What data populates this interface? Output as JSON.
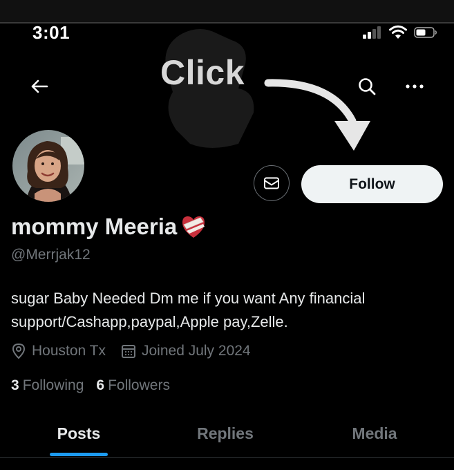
{
  "status_bar": {
    "time": "3:01"
  },
  "overlay": {
    "click_label": "Click"
  },
  "header": {
    "back_icon": "arrow-left-icon",
    "search_icon": "search-icon",
    "more_icon": "more-horizontal-icon"
  },
  "profile": {
    "display_name": "mommy Meeria",
    "name_emoji": "heart-with-bandage-emoji",
    "handle": "@Merrjak12",
    "bio": "sugar Baby Needed Dm me if you want Any financial support/Cashapp,paypal,Apple pay,Zelle.",
    "location": "Houston Tx",
    "joined": "Joined July 2024",
    "following_count": "3",
    "following_label": "Following",
    "followers_count": "6",
    "followers_label": "Followers"
  },
  "actions": {
    "message_icon": "envelope-icon",
    "follow_label": "Follow"
  },
  "tabs": [
    {
      "label": "Posts",
      "active": true
    },
    {
      "label": "Replies",
      "active": false
    },
    {
      "label": "Media",
      "active": false
    }
  ],
  "colors": {
    "background": "#000000",
    "text_primary": "#e7e9ea",
    "text_secondary": "#71767b",
    "follow_button_bg": "#eff3f4",
    "tab_indicator": "#1d9bf0"
  }
}
